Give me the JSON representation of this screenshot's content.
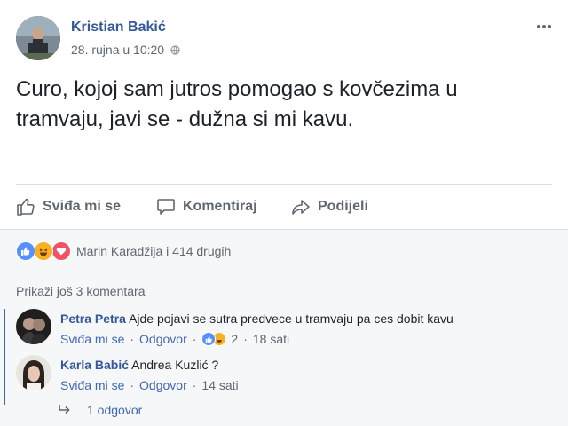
{
  "post": {
    "author": "Kristian Bakić",
    "timestamp": "28. rujna u 10:20",
    "text": "Curo, kojoj sam jutros pomogao s kovčezima u tramvaju, javi se - dužna si mi kavu."
  },
  "actions": {
    "like": "Sviđa mi se",
    "comment": "Komentiraj",
    "share": "Podijeli"
  },
  "reactions": {
    "text": "Marin Karadžija i 414 drugih",
    "icons": [
      "like-icon",
      "haha-icon",
      "love-icon"
    ]
  },
  "comments_section": {
    "view_more": "Prikaži još 3 komentara",
    "comments": [
      {
        "author": "Petra Petra",
        "text": "Ajde pojavi se sutra predvece u tramvaju pa ces dobit kavu",
        "like_label": "Sviđa mi se",
        "reply_label": "Odgovor",
        "reaction_count": "2",
        "time": "18 sati"
      },
      {
        "author": "Karla Babić",
        "text": "Andrea Kuzlić ?",
        "like_label": "Sviđa mi se",
        "reply_label": "Odgovor",
        "time": "14 sati"
      }
    ],
    "replies_link": "1 odgovor"
  },
  "colors": {
    "link": "#365899",
    "action_link": "#4267b2",
    "muted": "#606770",
    "like_blue": "#5890ff",
    "love_red": "#f25268",
    "haha_yellow": "#f7b125"
  }
}
